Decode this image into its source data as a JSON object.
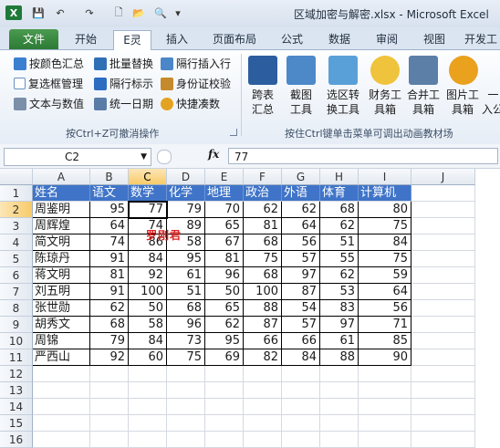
{
  "window": {
    "title": "区域加密与解密.xlsx - Microsoft Excel"
  },
  "quick_access": [
    "💾",
    "↶",
    "↷",
    "🗋",
    "📂",
    "🔍"
  ],
  "tabs": [
    {
      "label": "文件"
    },
    {
      "label": "开始"
    },
    {
      "label": "E灵"
    },
    {
      "label": "插入"
    },
    {
      "label": "页面布局"
    },
    {
      "label": "公式"
    },
    {
      "label": "数据"
    },
    {
      "label": "审阅"
    },
    {
      "label": "视图"
    },
    {
      "label": "开发工"
    }
  ],
  "ribbon": {
    "left_buttons": [
      {
        "label": "按颜色汇总",
        "color": "#3a7fd0"
      },
      {
        "label": "批量替换",
        "color": "#2f6fb6"
      },
      {
        "label": "隔行插入行",
        "color": "#4a86c8"
      },
      {
        "label": "复选框管理",
        "color": "#6a8fbf"
      },
      {
        "label": "隔行标示",
        "color": "#2d6cc0"
      },
      {
        "label": "身份证校验",
        "color": "#c58a2c"
      },
      {
        "label": "文本与数值",
        "color": "#7b8fa8"
      },
      {
        "label": "统一日期",
        "color": "#5a7da8"
      },
      {
        "label": "快捷凑数",
        "color": "#e3a321"
      }
    ],
    "left_group_label": "按Ctrl+Z可撤消操作",
    "big_buttons": [
      {
        "line1": "跨表",
        "line2": "汇总",
        "color": "#2c5d9f"
      },
      {
        "line1": "截图",
        "line2": "工具",
        "color": "#4d88c9"
      },
      {
        "line1": "选区转",
        "line2": "换工具",
        "color": "#5aa0d8"
      },
      {
        "line1": "财务工",
        "line2": "具箱",
        "color": "#f0c33c"
      },
      {
        "line1": "合并工",
        "line2": "具箱",
        "color": "#5c7fa8"
      },
      {
        "line1": "图片工",
        "line2": "具箱",
        "color": "#e9a11e"
      },
      {
        "line1": "一",
        "line2": "入公",
        "color": "#888888"
      }
    ],
    "right_group_label": "按住Ctrl键单击菜单可调出动画教材场"
  },
  "formula_bar": {
    "cell_ref": "C2",
    "fx": "fx",
    "value": "77"
  },
  "columns": [
    "A",
    "B",
    "C",
    "D",
    "E",
    "F",
    "G",
    "H",
    "I",
    "J"
  ],
  "rows": [
    "1",
    "2",
    "3",
    "4",
    "5",
    "6",
    "7",
    "8",
    "9",
    "10",
    "11",
    "12",
    "13",
    "14",
    "15",
    "16"
  ],
  "table": {
    "headers": [
      "姓名",
      "语文",
      "数学",
      "化学",
      "地理",
      "政治",
      "外语",
      "体育",
      "计算机"
    ],
    "records": [
      [
        "周鉴明",
        "95",
        "77",
        "79",
        "70",
        "62",
        "62",
        "68",
        "80"
      ],
      [
        "周辉煌",
        "64",
        "74",
        "89",
        "65",
        "81",
        "64",
        "62",
        "75"
      ],
      [
        "简文明",
        "74",
        "86",
        "58",
        "67",
        "68",
        "56",
        "51",
        "84"
      ],
      [
        "陈琼丹",
        "91",
        "84",
        "95",
        "81",
        "75",
        "57",
        "55",
        "75"
      ],
      [
        "蒋文明",
        "81",
        "92",
        "61",
        "96",
        "68",
        "97",
        "62",
        "59"
      ],
      [
        "刘五明",
        "91",
        "100",
        "51",
        "50",
        "100",
        "87",
        "53",
        "64"
      ],
      [
        "张世勋",
        "62",
        "50",
        "68",
        "65",
        "88",
        "54",
        "83",
        "56"
      ],
      [
        "胡秀文",
        "68",
        "58",
        "96",
        "62",
        "87",
        "57",
        "97",
        "71"
      ],
      [
        "周锦",
        "79",
        "84",
        "73",
        "95",
        "66",
        "66",
        "61",
        "85"
      ],
      [
        "严西山",
        "92",
        "60",
        "75",
        "69",
        "82",
        "84",
        "88",
        "90"
      ]
    ]
  },
  "annotation": {
    "text": "罗刚君"
  }
}
